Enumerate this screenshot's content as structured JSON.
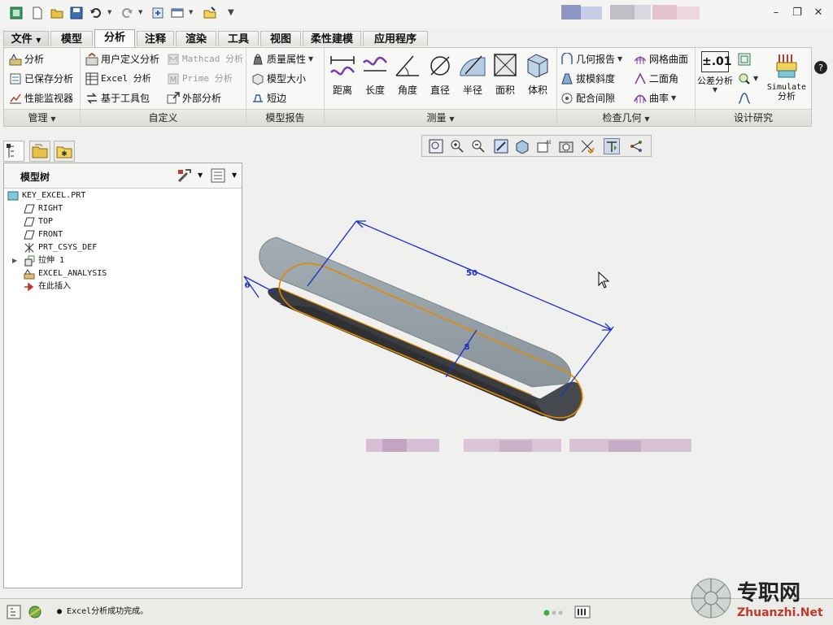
{
  "quick_access": {
    "icons": [
      "app-icon",
      "new-icon",
      "open-icon",
      "save-icon",
      "undo-icon",
      "redo-icon",
      "regenerate-icon",
      "windows-icon",
      "close-window-icon",
      "customize-icon"
    ]
  },
  "tabs": [
    {
      "label": "文件",
      "has_dropdown": true
    },
    {
      "label": "模型"
    },
    {
      "label": "分析",
      "active": true
    },
    {
      "label": "注释"
    },
    {
      "label": "渲染"
    },
    {
      "label": "工具"
    },
    {
      "label": "视图"
    },
    {
      "label": "柔性建模"
    },
    {
      "label": "应用程序"
    }
  ],
  "ribbon": {
    "manage": {
      "label": "管理",
      "items": [
        "分析",
        "已保存分析",
        "性能监视器"
      ]
    },
    "custom": {
      "label": "自定义",
      "items": [
        "用户定义分析",
        "Excel 分析",
        "基于工具包",
        "Mathcad 分析",
        "Prime 分析",
        "外部分析"
      ]
    },
    "model_report": {
      "label": "模型报告",
      "items": [
        "质量属性",
        "模型大小",
        "短边"
      ]
    },
    "measure": {
      "label": "测量",
      "items": [
        "距离",
        "长度",
        "角度",
        "直径",
        "半径",
        "面积",
        "体积"
      ]
    },
    "inspect": {
      "label": "检查几何",
      "items": [
        "几何报告",
        "拔模斜度",
        "配合间隙",
        "网格曲面",
        "二面角",
        "曲率"
      ]
    },
    "design": {
      "label": "设计研究",
      "items": [
        "公差分析",
        "Simulate",
        "分析"
      ],
      "tolerance_icon_text": "±.01"
    }
  },
  "model_tree": {
    "title": "模型树",
    "nodes": [
      {
        "label": "KEY_EXCEL.PRT",
        "icon": "part-icon"
      },
      {
        "label": "RIGHT",
        "icon": "datum-plane-icon"
      },
      {
        "label": "TOP",
        "icon": "datum-plane-icon"
      },
      {
        "label": "FRONT",
        "icon": "datum-plane-icon"
      },
      {
        "label": "PRT_CSYS_DEF",
        "icon": "csys-icon"
      },
      {
        "label": "拉伸 1",
        "icon": "extrude-icon"
      },
      {
        "label": "EXCEL_ANALYSIS",
        "icon": "analysis-icon"
      },
      {
        "label": "在此插入",
        "icon": "insert-here-icon"
      }
    ]
  },
  "dimensions": {
    "length": "50",
    "width": "8",
    "height": "6"
  },
  "status": {
    "message": "Excel分析成功完成。"
  },
  "watermark": {
    "site": "Zhuanzhi.Net",
    "brand": "专职网"
  },
  "colors": {
    "accent": "#1a5fb4",
    "dimension": "#1c2fc8",
    "highlight": "#e08a00",
    "body_top": "#8f9aa1",
    "body_side": "#3b3d40"
  }
}
